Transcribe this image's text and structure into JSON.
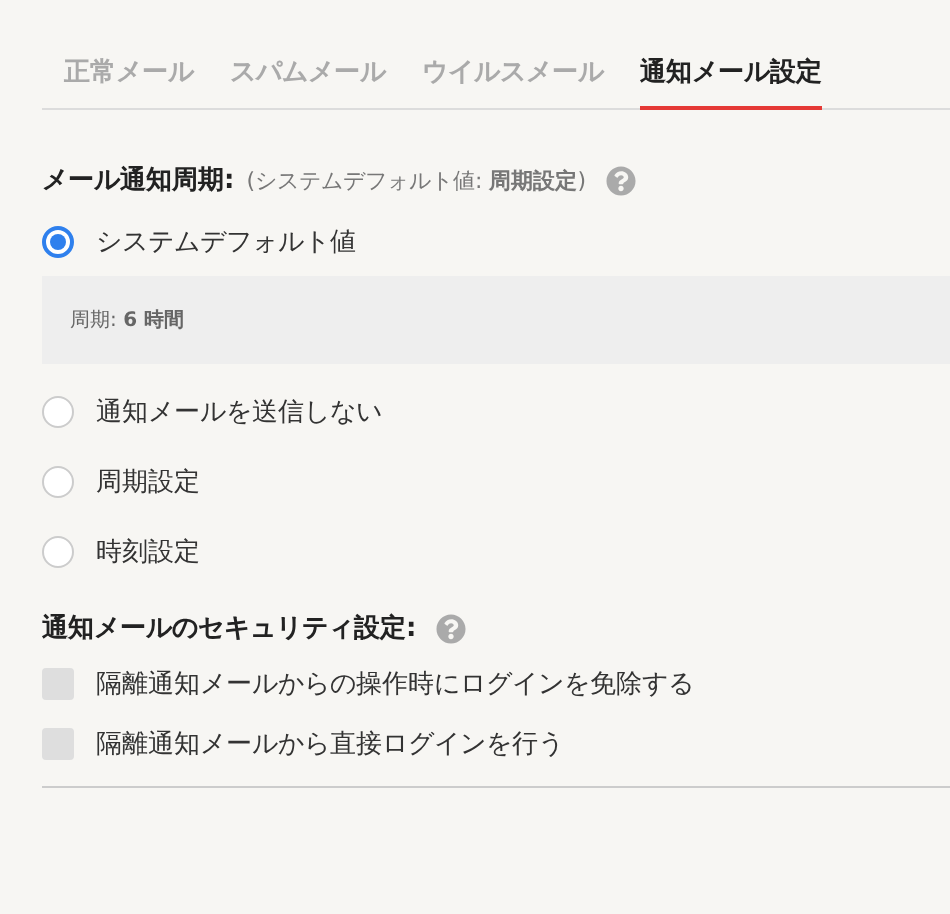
{
  "tabs": [
    {
      "label": "正常メール",
      "selected": false
    },
    {
      "label": "スパムメール",
      "selected": false
    },
    {
      "label": "ウイルスメール",
      "selected": false
    },
    {
      "label": "通知メール設定",
      "selected": true
    }
  ],
  "period": {
    "title": "メール通知周期:",
    "note": "(システムデフォルト値: **周期設定**)",
    "options": [
      {
        "label": "システムデフォルト値",
        "selected": true,
        "detail": "周期: **6 時間**"
      },
      {
        "label": "通知メールを送信しない",
        "selected": false
      },
      {
        "label": "周期設定",
        "selected": false
      },
      {
        "label": "時刻設定",
        "selected": false
      }
    ]
  },
  "security": {
    "title": "通知メールのセキュリティ設定:",
    "options": [
      {
        "label": "隔離通知メールからの操作時にログインを免除する",
        "checked": false,
        "disabled": true
      },
      {
        "label": "隔離通知メールから直接ログインを行う",
        "checked": false,
        "disabled": true
      }
    ]
  }
}
